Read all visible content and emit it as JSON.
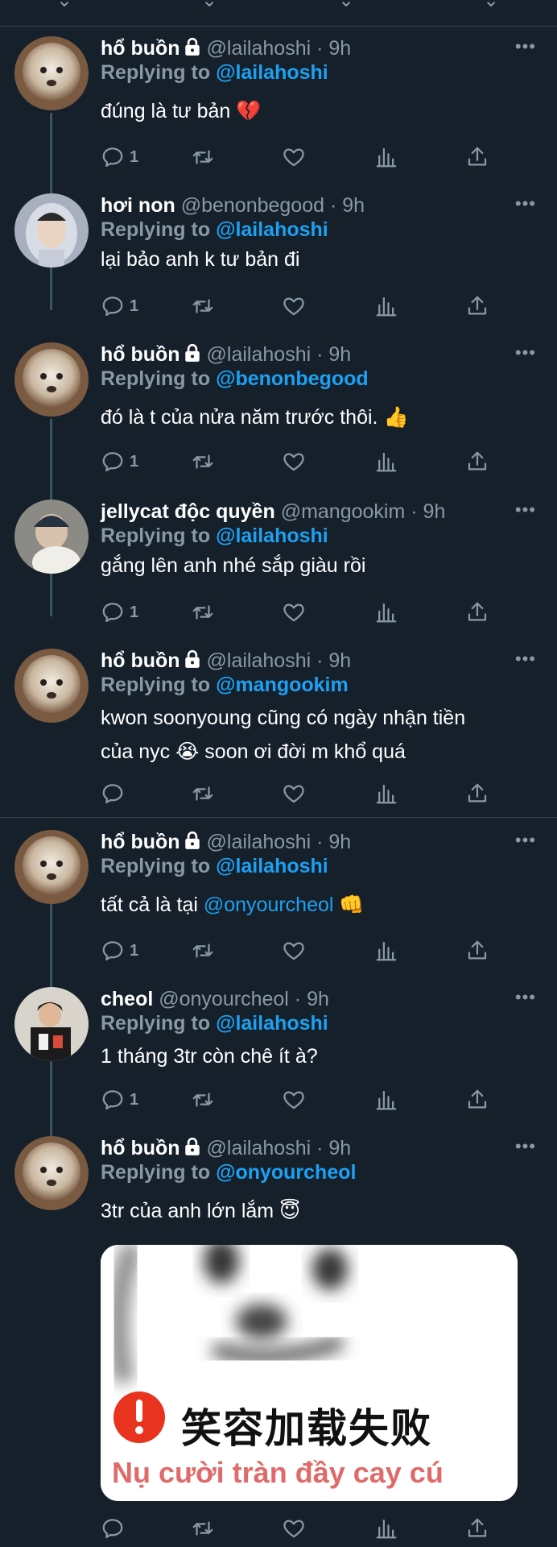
{
  "tweets": [
    {
      "name": "hổ buồn",
      "locked": true,
      "handle": "@lailahoshi",
      "time": "· 9h",
      "reply_prefix": "Replying to",
      "reply_to": "@lailahoshi",
      "text": "đúng là tư bản",
      "emoji": "💔",
      "replies": "1"
    },
    {
      "name": "hơi non",
      "locked": false,
      "handle": "@benonbegood",
      "time": "· 9h",
      "reply_prefix": "Replying to",
      "reply_to": "@lailahoshi",
      "text": "lại bảo anh k tư bản đi",
      "emoji": "",
      "replies": "1"
    },
    {
      "name": "hổ buồn",
      "locked": true,
      "handle": "@lailahoshi",
      "time": "· 9h",
      "reply_prefix": "Replying to",
      "reply_to": "@benonbegood",
      "text": "đó là t của nửa năm trước thôi.",
      "emoji": "👍",
      "replies": "1"
    },
    {
      "name": "jellycat độc quyền",
      "locked": false,
      "handle": "@mangookim",
      "time": "· 9h",
      "reply_prefix": "Replying to",
      "reply_to": "@lailahoshi",
      "text": "gắng lên anh nhé sắp giàu rồi",
      "emoji": "",
      "replies": "1"
    },
    {
      "name": "hổ buồn",
      "locked": true,
      "handle": "@lailahoshi",
      "time": "· 9h",
      "reply_prefix": "Replying to",
      "reply_to": "@mangookim",
      "text_line1": "kwon soonyoung cũng có ngày nhận tiền",
      "text_line2_a": "của nyc",
      "emoji": "😭",
      "text_line2_b": "soon ơi đời m khổ quá",
      "replies": ""
    },
    {
      "name": "hổ buồn",
      "locked": true,
      "handle": "@lailahoshi",
      "time": "· 9h",
      "reply_prefix": "Replying to",
      "reply_to": "@lailahoshi",
      "text": "tất cả là tại",
      "text_mention": "@onyourcheol",
      "emoji": "👊",
      "replies": "1"
    },
    {
      "name": "cheol",
      "locked": false,
      "handle": "@onyourcheol",
      "time": "· 9h",
      "reply_prefix": "Replying to",
      "reply_to": "@lailahoshi",
      "text": "1 tháng 3tr còn chê ít à?",
      "emoji": "",
      "replies": "1"
    },
    {
      "name": "hổ buồn",
      "locked": true,
      "handle": "@lailahoshi",
      "time": "· 9h",
      "reply_prefix": "Replying to",
      "reply_to": "@onyourcheol",
      "text": "3tr của anh lớn lắm",
      "emoji": "😇",
      "replies": ""
    }
  ],
  "media": {
    "chinese_text": "笑容加载失败",
    "vietnamese_text": "Nụ cười tràn đầy cay cú"
  },
  "colors": {
    "background": "#15202b",
    "mention": "#1da1f2",
    "secondary": "#8899a6",
    "divider": "#38444d"
  },
  "icons": {
    "more": "•••",
    "reply": "reply-icon",
    "retweet": "retweet-icon",
    "like": "like-icon",
    "analytics": "analytics-icon",
    "share": "share-icon"
  }
}
